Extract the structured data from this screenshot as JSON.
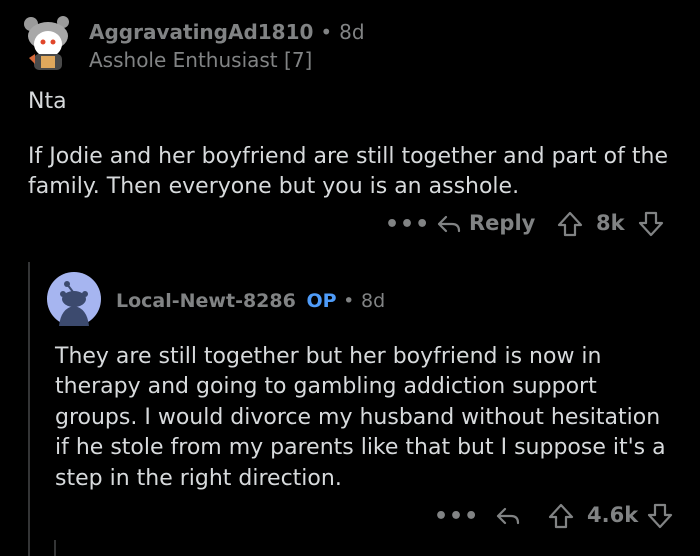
{
  "comment": {
    "author": "AggravatingAd1810",
    "separator": "•",
    "age": "8d",
    "flair": "Asshole Enthusiast [7]",
    "body_lines": [
      "Nta",
      "If Jodie and her boyfriend are still together and part of the family. Then everyone but you is an asshole."
    ],
    "actions": {
      "more": "•••",
      "reply": "Reply",
      "votes": "8k"
    }
  },
  "reply": {
    "author": "Local-Newt-8286",
    "op_badge": "OP",
    "separator": "•",
    "age": "8d",
    "body": "They are still together but her boyfriend is now in therapy and going to gambling addiction support groups. I would divorce my husband without hesitation if he stole from my parents like that but I suppose it's a step in the right direction.",
    "actions": {
      "more": "•••",
      "votes": "4.6k"
    }
  },
  "icons": [
    "snoo-avatar-icon",
    "default-avatar-icon",
    "reply-arrow-icon",
    "upvote-icon",
    "downvote-icon",
    "more-icon"
  ],
  "colors": {
    "background": "#000000",
    "text": "#d7dadc",
    "meta": "#818384",
    "op": "#4f9cf9",
    "avatar_bg": "#a6b5f0"
  }
}
